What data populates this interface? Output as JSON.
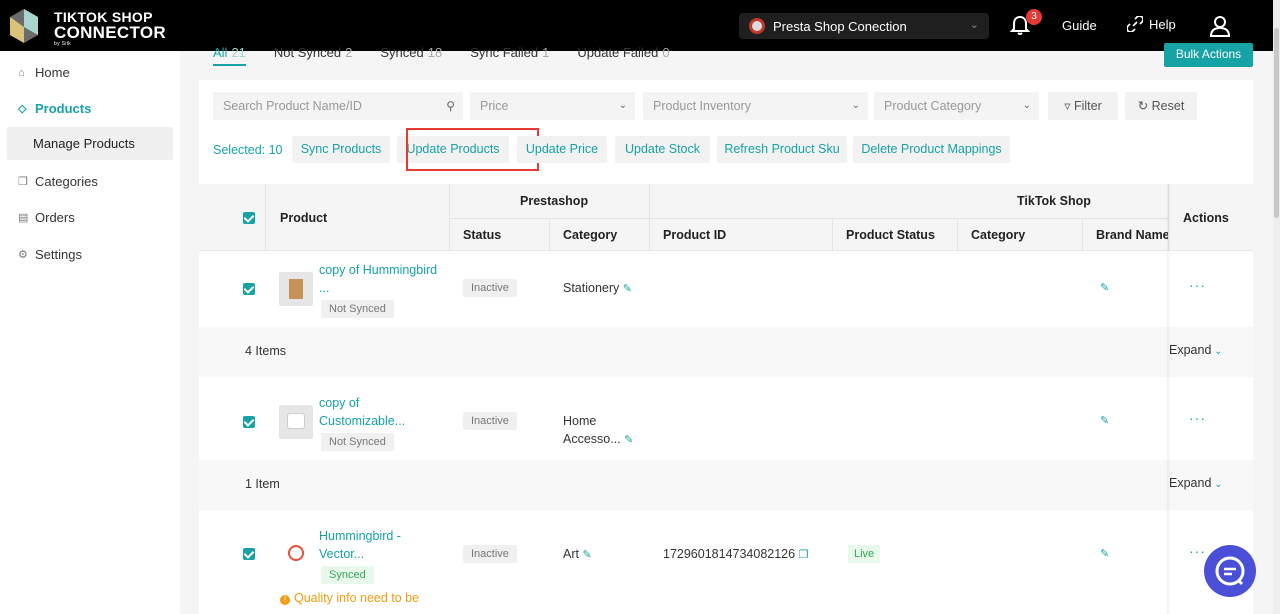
{
  "app": {
    "logo_line1": "TIKTOK SHOP",
    "logo_line2": "CONNECTOR",
    "logo_line3": "by Sitk",
    "shop_selector": "Presta Shop Conection",
    "notifications_count": "3",
    "guide_label": "Guide",
    "help_label": "Help"
  },
  "sidebar": {
    "items": [
      {
        "label": "Home",
        "icon": "home-icon"
      },
      {
        "label": "Products",
        "icon": "tag-icon"
      },
      {
        "label": "Manage Products",
        "icon": ""
      },
      {
        "label": "Categories",
        "icon": "copy-icon"
      },
      {
        "label": "Orders",
        "icon": "inbox-icon"
      },
      {
        "label": "Settings",
        "icon": "gear-icon"
      }
    ]
  },
  "tabs": [
    {
      "label": "All",
      "count": "21"
    },
    {
      "label": "Not Synced",
      "count": "2"
    },
    {
      "label": "Synced",
      "count": "18"
    },
    {
      "label": "Sync Failed",
      "count": "1"
    },
    {
      "label": "Update Failed",
      "count": "0"
    }
  ],
  "bulk_actions_label": "Bulk Actions",
  "filters": {
    "search_placeholder": "Search Product Name/ID",
    "price": "Price",
    "inventory": "Product Inventory",
    "category": "Product Category",
    "filter_label": "Filter",
    "reset_label": "Reset"
  },
  "actions": {
    "selected": "Selected: 10",
    "sync": "Sync Products",
    "update": "Update Products",
    "update_price": "Update Price",
    "update_stock": "Update Stock",
    "refresh_sku": "Refresh Product Sku",
    "delete_mappings": "Delete Product Mappings"
  },
  "table": {
    "headers": {
      "product": "Product",
      "prestashop": "Prestashop",
      "tiktok": "TikTok Shop",
      "actions": "Actions",
      "status": "Status",
      "category": "Category",
      "product_id": "Product ID",
      "product_status": "Product Status",
      "tt_category": "Category",
      "brand": "Brand Name"
    },
    "rows": [
      {
        "name_l1": "copy of Hummingbird",
        "name_l2": "...",
        "sync": "Not Synced",
        "status": "Inactive",
        "category_l1": "Stationery",
        "category_l2": "",
        "product_id": "",
        "product_status": "",
        "group": "4 Items"
      },
      {
        "name_l1": "copy of",
        "name_l2": "Customizable...",
        "sync": "Not Synced",
        "status": "Inactive",
        "category_l1": "Home",
        "category_l2": "Accesso...",
        "product_id": "",
        "product_status": "",
        "group": "1 Item"
      },
      {
        "name_l1": "Hummingbird -",
        "name_l2": "Vector...",
        "sync": "Synced",
        "status": "Inactive",
        "category_l1": "Art",
        "category_l2": "",
        "product_id": "1729601814734082126",
        "product_status": "Live",
        "warning": "Quality info need to be"
      }
    ],
    "expand_label": "Expand"
  },
  "colors": {
    "accent": "#17a2a5",
    "header_bg": "#000000",
    "highlight": "#e53935"
  }
}
